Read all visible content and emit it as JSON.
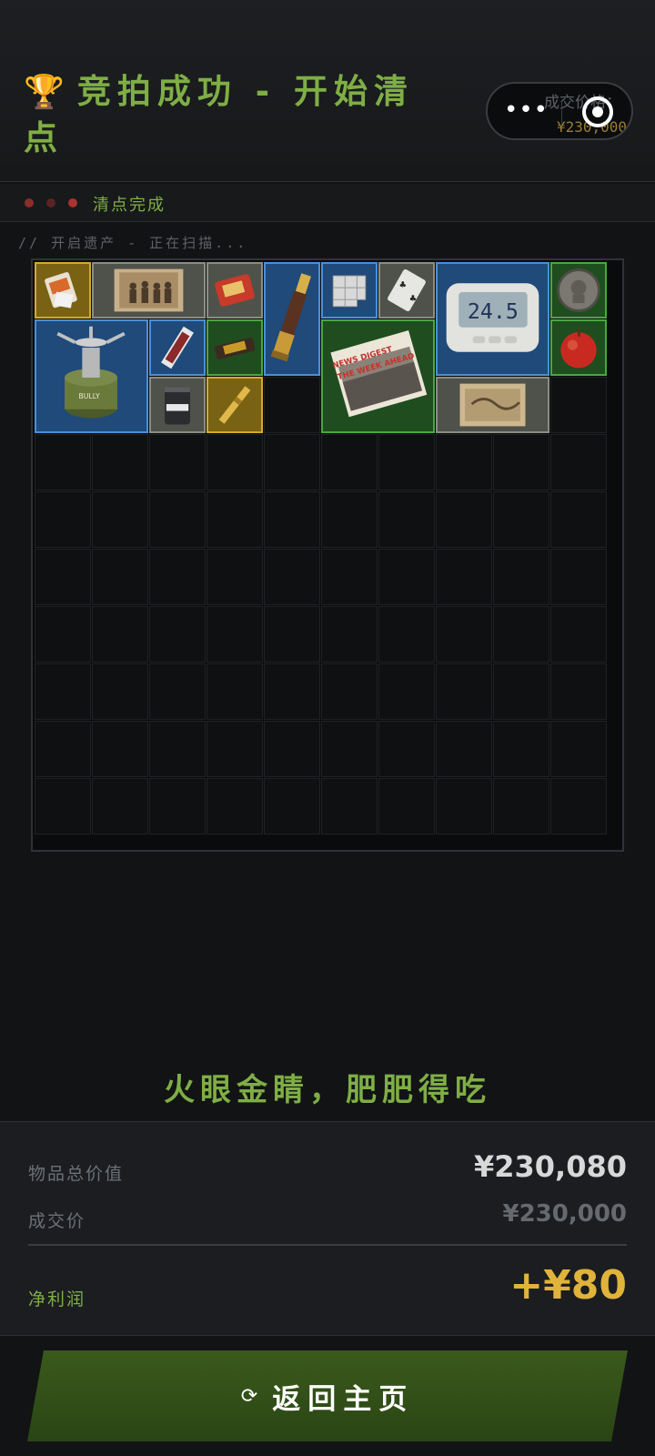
{
  "header": {
    "trophy_icon": "trophy-icon",
    "title": "竞拍成功 - 开始清点",
    "price_label": "成交价格：",
    "price_value": "¥230,000"
  },
  "status": {
    "text": "清点完成"
  },
  "scan": {
    "text": "// 开启遗产 - 正在扫描..."
  },
  "grid": {
    "cols": 10,
    "rows": 10,
    "items": [
      {
        "name": "instant-noodle-bag",
        "rarity": "gold"
      },
      {
        "name": "old-family-photo",
        "rarity": "gray"
      },
      {
        "name": "snack-bag",
        "rarity": "gray"
      },
      {
        "name": "brass-spyglass",
        "rarity": "blue"
      },
      {
        "name": "sugar-cubes",
        "rarity": "blue"
      },
      {
        "name": "playing-card",
        "rarity": "gray"
      },
      {
        "name": "digital-alarm-clock",
        "rarity": "blue",
        "display": "24.5"
      },
      {
        "name": "silver-coin",
        "rarity": "green"
      },
      {
        "name": "camping-gas-stove",
        "rarity": "blue"
      },
      {
        "name": "chewing-gum-pack",
        "rarity": "blue"
      },
      {
        "name": "chocolate-bar",
        "rarity": "green"
      },
      {
        "name": "news-digest-newspaper",
        "rarity": "green",
        "headline": "NEWS DIGEST",
        "subheadline": "THE WEEK AHEAD"
      },
      {
        "name": "red-apple",
        "rarity": "green"
      },
      {
        "name": "protein-powder-can",
        "rarity": "gray"
      },
      {
        "name": "golden-pen",
        "rarity": "gold"
      },
      {
        "name": "old-map-photo",
        "rarity": "gray"
      }
    ]
  },
  "slogan": "火眼金睛，肥肥得吃",
  "summary": {
    "total_label": "物品总价值",
    "total_value": "¥230,080",
    "deal_label": "成交价",
    "deal_value": "¥230,000",
    "profit_label": "净利润",
    "profit_value": "+¥80"
  },
  "return_button": {
    "label": "返回主页"
  },
  "colors": {
    "accent_green": "#7fae45",
    "gold": "#e0b33a",
    "rarity_gray": "#8a8d80",
    "rarity_blue": "#4b8fd8",
    "rarity_green": "#48a83e",
    "rarity_gold": "#d4aa2c"
  }
}
